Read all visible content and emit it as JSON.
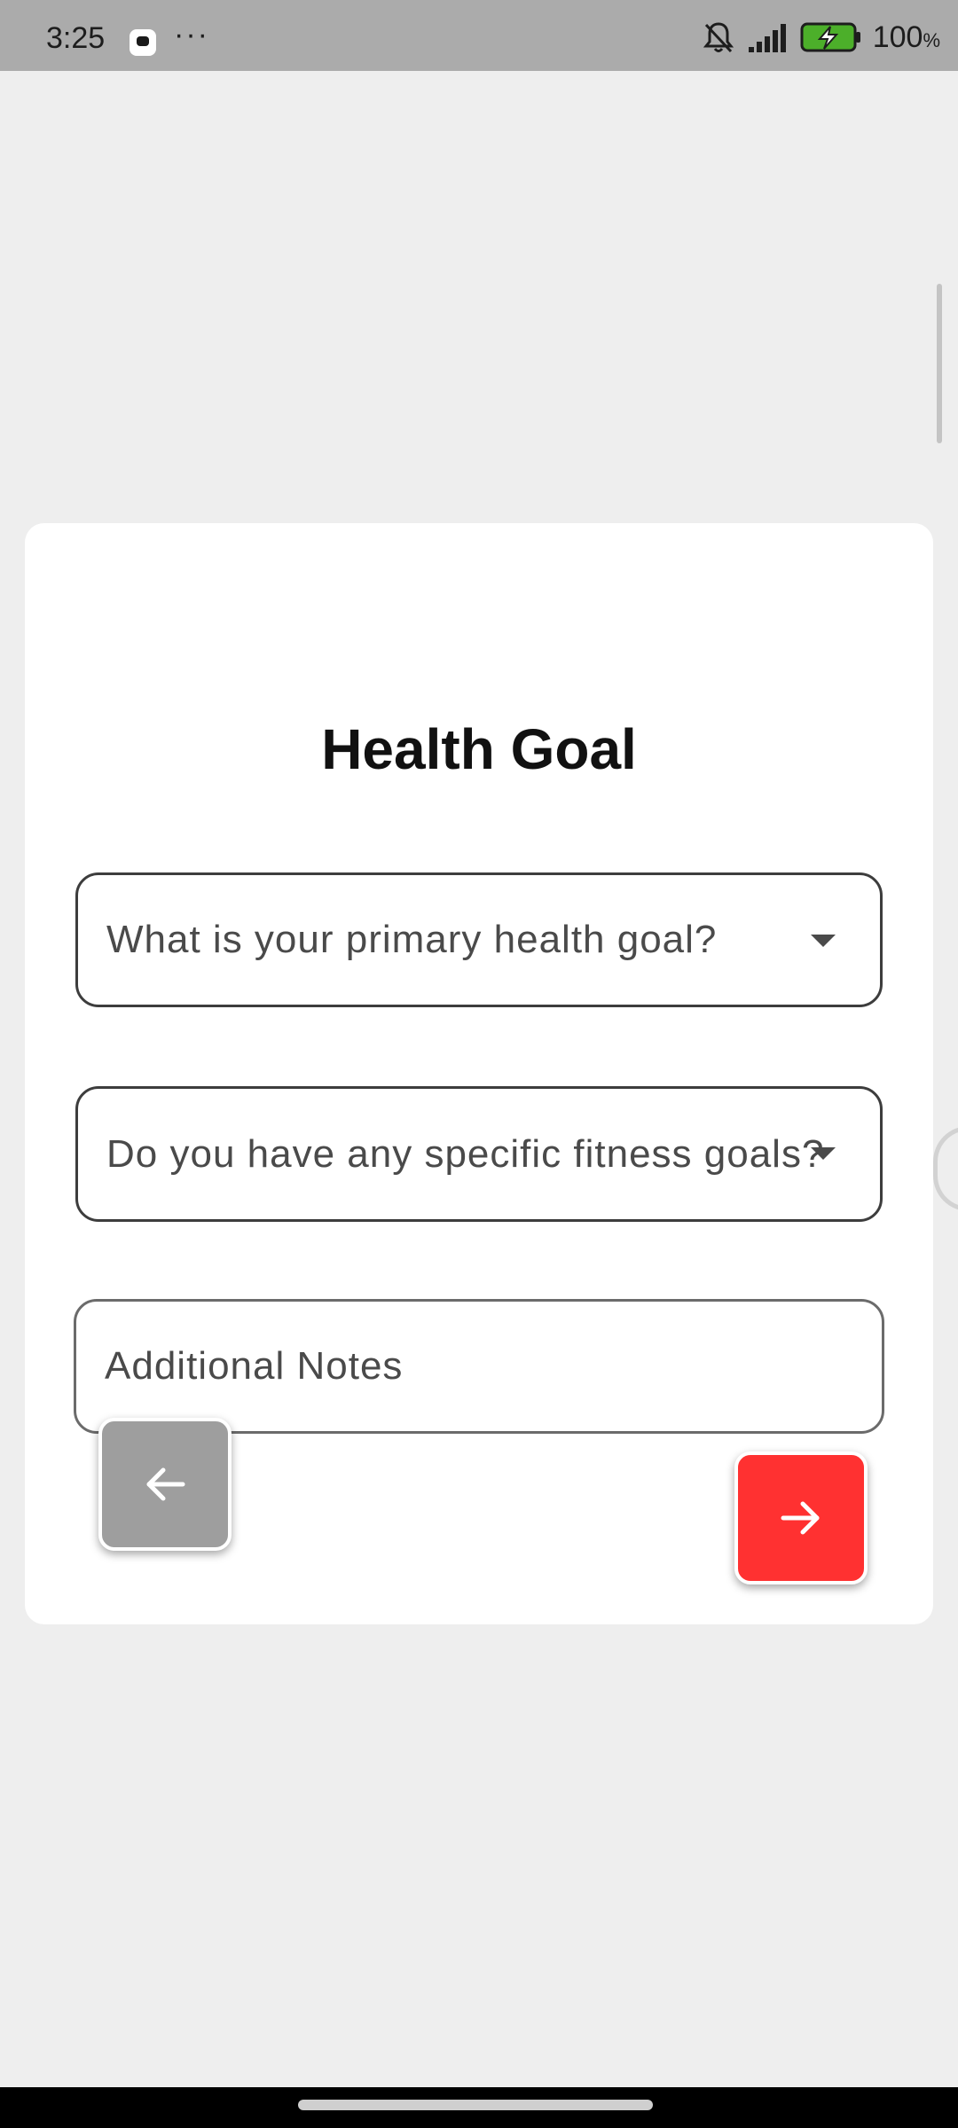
{
  "status_bar": {
    "time": "3:25",
    "dots": "···",
    "battery": "100",
    "battery_unit": "%"
  },
  "form": {
    "title": "Health Goal",
    "primary_goal": {
      "label": "What is your primary health goal?"
    },
    "fitness_goals": {
      "label": "Do you have any specific fitness goals?"
    },
    "notes": {
      "label": "Additional Notes"
    }
  },
  "buttons": {
    "back": {
      "icon": "arrow-left-icon"
    },
    "next": {
      "icon": "arrow-right-icon"
    }
  },
  "colors": {
    "next_button": "#ff3131",
    "back_button": "#9e9e9e",
    "card": "#ffffff",
    "background": "#eeeeee"
  }
}
